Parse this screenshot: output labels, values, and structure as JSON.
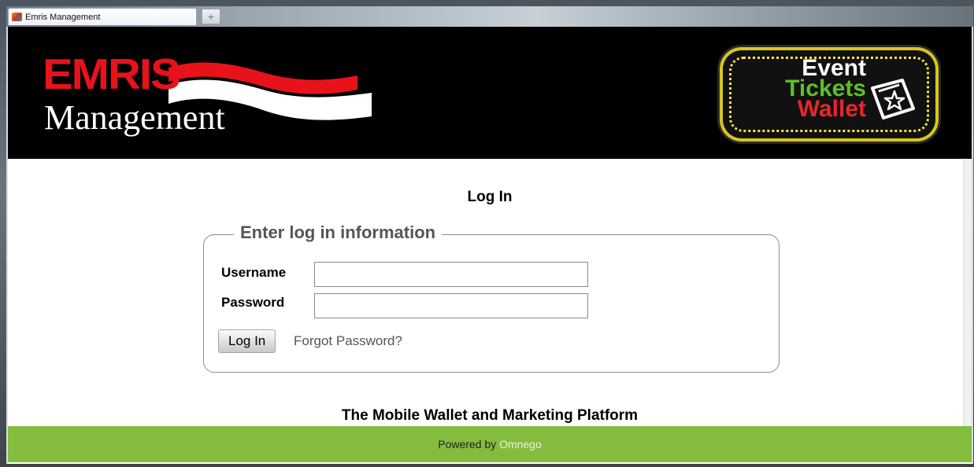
{
  "browser": {
    "tab_title": "Emris Management",
    "new_tab_symbol": "+"
  },
  "header": {
    "logo_brand": "EMRIS",
    "logo_sub": "Management",
    "badge_line1": "Event",
    "badge_line2": "Tickets",
    "badge_line3": "Wallet"
  },
  "login": {
    "title": "Log In",
    "legend": "Enter log in information",
    "username_label": "Username",
    "username_value": "",
    "password_label": "Password",
    "password_value": "",
    "submit_label": "Log In",
    "forgot_label": "Forgot Password?"
  },
  "tagline": "The Mobile Wallet and Marketing Platform",
  "footer": {
    "powered_by": "Powered by",
    "brand_link": "Omnego"
  },
  "colors": {
    "brand_red": "#e8121b",
    "footer_green": "#84bc3e",
    "badge_yellow": "#d8c61c"
  },
  "icons": {
    "favicon": "emris-favicon-icon",
    "wallet": "wallet-star-icon"
  }
}
